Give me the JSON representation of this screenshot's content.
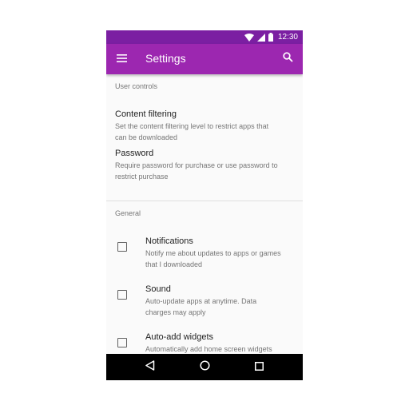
{
  "status_bar": {
    "time": "12:30",
    "icons": [
      "wifi-icon",
      "cell-signal-icon",
      "battery-icon"
    ]
  },
  "app_bar": {
    "title": "Settings",
    "menu_icon": "menu-icon",
    "search_icon": "search-icon"
  },
  "colors": {
    "status_bar": "#7b1fa2",
    "app_bar": "#9c27b0"
  },
  "sections": {
    "user_controls": {
      "header": "User controls",
      "items": [
        {
          "title": "Content filtering",
          "subtitle_line1": "Set the content filtering level to restrict apps that",
          "subtitle_line2": "can be downloaded"
        },
        {
          "title": "Password",
          "subtitle_line1": "Require password for purchase or use password to",
          "subtitle_line2": "restrict purchase"
        }
      ]
    },
    "general": {
      "header": "General",
      "items": [
        {
          "title": "Notifications",
          "subtitle_line1": "Notify me about updates to apps or games",
          "subtitle_line2": "that I downloaded",
          "checked": false
        },
        {
          "title": "Sound",
          "subtitle_line1": "Auto-update apps at anytime. Data",
          "subtitle_line2": "charges may apply",
          "checked": false
        },
        {
          "title": "Auto-add widgets",
          "subtitle_line1": "Automatically add home screen widgets",
          "subtitle_line2": "",
          "checked": false
        }
      ]
    }
  },
  "nav_bar": {
    "icons": [
      "back-icon",
      "home-icon",
      "recents-icon"
    ]
  }
}
